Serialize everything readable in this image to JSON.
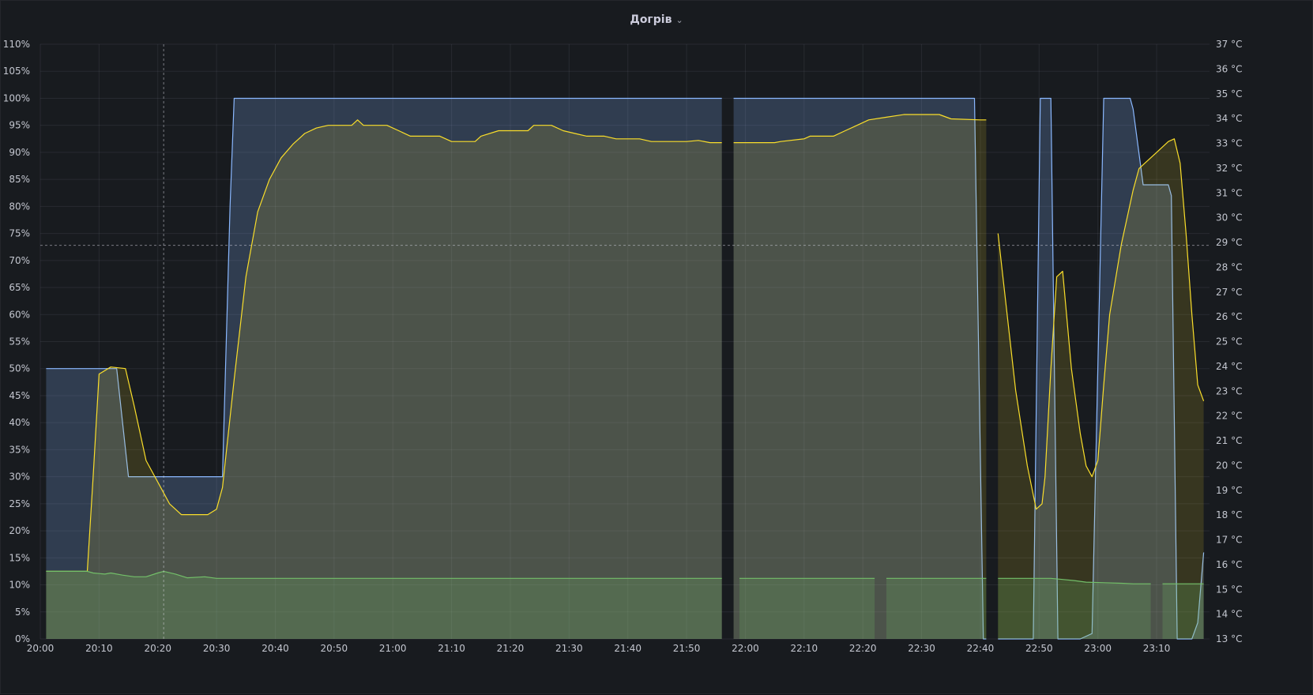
{
  "panel": {
    "title": "Догрів",
    "menu_icon": "chevron-down-icon"
  },
  "chart_data": {
    "type": "area",
    "x_range": [
      "20:00",
      "23:19"
    ],
    "x_ticks": [
      "20:00",
      "20:10",
      "20:20",
      "20:30",
      "20:40",
      "20:50",
      "21:00",
      "21:10",
      "21:20",
      "21:30",
      "21:40",
      "21:50",
      "22:00",
      "22:10",
      "22:20",
      "22:30",
      "22:40",
      "22:50",
      "23:00",
      "23:10"
    ],
    "y_left": {
      "unit": "%",
      "ylim": [
        0,
        110
      ],
      "ticks": [
        "0%",
        "5%",
        "10%",
        "15%",
        "20%",
        "25%",
        "30%",
        "35%",
        "40%",
        "45%",
        "50%",
        "55%",
        "60%",
        "65%",
        "70%",
        "75%",
        "80%",
        "85%",
        "90%",
        "95%",
        "100%",
        "105%",
        "110%"
      ]
    },
    "y_right": {
      "unit": "°C",
      "ylim": [
        13,
        37
      ],
      "ticks": [
        "13 °C",
        "14 °C",
        "15 °C",
        "16 °C",
        "17 °C",
        "18 °C",
        "19 °C",
        "20 °C",
        "21 °C",
        "22 °C",
        "23 °C",
        "24 °C",
        "25 °C",
        "26 °C",
        "27 °C",
        "28 °C",
        "29 °C",
        "30 °C",
        "31 °C",
        "32 °C",
        "33 °C",
        "34 °C",
        "35 °C",
        "36 °C",
        "37 °C"
      ]
    },
    "grid": true,
    "colors": {
      "blue": "#8ab8ff",
      "yellow": "#fade2a",
      "green": "#73bf69"
    },
    "crosshair": {
      "x": "20:21",
      "y_percent": 72.8
    },
    "series": [
      {
        "color": "blue",
        "axis": "left",
        "segments": [
          [
            [
              1,
              50
            ],
            [
              13,
              50
            ],
            [
              15,
              30
            ],
            [
              31,
              30
            ],
            [
              32.3,
              80
            ],
            [
              33,
              100
            ],
            [
              116,
              100
            ]
          ],
          [
            [
              118,
              100
            ],
            [
              159,
              100
            ],
            [
              160.5,
              0
            ],
            [
              161,
              0
            ]
          ],
          [
            [
              163,
              0
            ],
            [
              169,
              0
            ],
            [
              170.2,
              100
            ],
            [
              172,
              100
            ],
            [
              173.2,
              0
            ],
            [
              177,
              0
            ],
            [
              179,
              1
            ],
            [
              181,
              100
            ],
            [
              185.5,
              100
            ],
            [
              186,
              98
            ],
            [
              187.7,
              84
            ],
            [
              192,
              84
            ],
            [
              192.5,
              82
            ],
            [
              193.5,
              0
            ],
            [
              196,
              0
            ],
            [
              197,
              3
            ],
            [
              198,
              16
            ]
          ]
        ]
      },
      {
        "color": "yellow",
        "axis": "left",
        "segments": [
          [
            [
              1,
              12.5
            ],
            [
              8,
              12.5
            ],
            [
              9,
              30
            ],
            [
              10,
              49
            ],
            [
              12,
              50.3
            ],
            [
              14.5,
              50
            ],
            [
              16,
              43
            ],
            [
              18,
              33
            ],
            [
              20.5,
              28
            ],
            [
              22,
              25
            ],
            [
              24,
              23
            ],
            [
              28.5,
              23
            ],
            [
              30,
              24
            ],
            [
              31,
              28
            ],
            [
              33,
              48
            ],
            [
              35,
              67
            ],
            [
              37,
              79
            ],
            [
              39,
              85
            ],
            [
              41,
              89
            ],
            [
              43,
              91.5
            ],
            [
              45,
              93.5
            ],
            [
              47,
              94.5
            ],
            [
              49,
              95
            ],
            [
              53,
              95
            ],
            [
              54,
              96
            ],
            [
              55,
              95
            ],
            [
              59,
              95
            ],
            [
              61,
              94
            ],
            [
              63,
              93
            ],
            [
              68,
              93
            ],
            [
              70,
              92
            ],
            [
              74,
              92
            ],
            [
              75,
              93
            ],
            [
              78,
              94
            ],
            [
              83,
              94
            ],
            [
              84,
              95
            ],
            [
              87,
              95
            ],
            [
              89,
              94
            ],
            [
              91,
              93.5
            ],
            [
              93,
              93
            ],
            [
              96,
              93
            ],
            [
              98,
              92.5
            ],
            [
              102,
              92.5
            ],
            [
              104,
              92
            ],
            [
              110,
              92
            ],
            [
              112,
              92.2
            ],
            [
              114,
              91.8
            ],
            [
              116,
              91.8
            ]
          ],
          [
            [
              118,
              91.8
            ],
            [
              125,
              91.8
            ],
            [
              126,
              92
            ],
            [
              130,
              92.5
            ],
            [
              131,
              93
            ],
            [
              135,
              93
            ],
            [
              137,
              94
            ],
            [
              139,
              95
            ],
            [
              141,
              96
            ],
            [
              144,
              96.5
            ],
            [
              147,
              97
            ],
            [
              153,
              97
            ],
            [
              155,
              96.2
            ],
            [
              160,
              96
            ],
            [
              161,
              96
            ]
          ],
          [
            [
              163,
              75
            ],
            [
              166,
              46
            ],
            [
              168,
              32
            ],
            [
              169.5,
              24
            ],
            [
              170.5,
              25
            ],
            [
              171,
              30
            ],
            [
              172,
              50
            ],
            [
              173,
              67
            ],
            [
              174,
              68
            ],
            [
              175.5,
              50
            ],
            [
              177,
              38
            ],
            [
              178,
              32
            ],
            [
              179,
              30
            ],
            [
              180,
              33
            ],
            [
              181,
              47
            ],
            [
              182,
              60
            ],
            [
              184,
              73
            ],
            [
              186,
              83
            ],
            [
              187,
              87
            ],
            [
              188,
              88
            ],
            [
              190,
              90
            ],
            [
              192,
              92
            ],
            [
              193,
              92.5
            ],
            [
              194,
              88
            ],
            [
              195,
              75
            ],
            [
              196,
              60
            ],
            [
              197,
              47
            ],
            [
              198,
              44
            ]
          ]
        ]
      },
      {
        "color": "green",
        "axis": "left",
        "segments": [
          [
            [
              1,
              12.5
            ],
            [
              8,
              12.5
            ],
            [
              9,
              12.2
            ],
            [
              11,
              12
            ],
            [
              12,
              12.2
            ],
            [
              14,
              11.8
            ],
            [
              16,
              11.5
            ],
            [
              18,
              11.5
            ],
            [
              20,
              12.2
            ],
            [
              21,
              12.5
            ],
            [
              23,
              12
            ],
            [
              25,
              11.3
            ],
            [
              28,
              11.5
            ],
            [
              30,
              11.2
            ],
            [
              33,
              11.2
            ],
            [
              116,
              11.2
            ]
          ],
          [
            [
              119,
              11.2
            ],
            [
              142,
              11.2
            ]
          ],
          [
            [
              144,
              11.2
            ],
            [
              161,
              11.2
            ]
          ],
          [
            [
              163,
              11.2
            ],
            [
              172,
              11.2
            ],
            [
              174,
              11
            ],
            [
              176,
              10.8
            ],
            [
              178,
              10.5
            ],
            [
              184,
              10.3
            ],
            [
              186,
              10.2
            ],
            [
              189,
              10.2
            ]
          ],
          [
            [
              191,
              10.2
            ],
            [
              198,
              10.2
            ]
          ]
        ]
      }
    ]
  }
}
